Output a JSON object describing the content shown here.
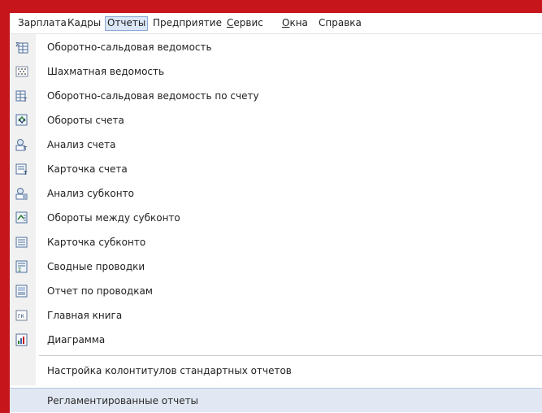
{
  "menubar": {
    "items": [
      {
        "label": "Зарплата"
      },
      {
        "label": "Кадры"
      },
      {
        "label": "Отчеты"
      },
      {
        "label": "Предприятие"
      },
      {
        "label": "ервис",
        "mnemonic": "С"
      },
      {
        "label": "кна",
        "mnemonic": "О"
      },
      {
        "label": "Справка"
      }
    ],
    "active_index": 2
  },
  "reports_menu": {
    "items": [
      {
        "label": "Оборотно-сальдовая ведомость",
        "icon": "turnover-balance-sheet-icon"
      },
      {
        "label": "Шахматная ведомость",
        "icon": "chess-sheet-icon"
      },
      {
        "label": "Оборотно-сальдовая ведомость по счету",
        "icon": "account-turnover-balance-icon"
      },
      {
        "label": "Обороты счета",
        "icon": "account-turnovers-icon"
      },
      {
        "label": "Анализ счета",
        "icon": "account-analysis-icon"
      },
      {
        "label": "Карточка счета",
        "icon": "account-card-icon"
      },
      {
        "label": "Анализ субконто",
        "icon": "subconto-analysis-icon"
      },
      {
        "label": "Обороты между субконто",
        "icon": "subconto-turnovers-icon"
      },
      {
        "label": "Карточка субконто",
        "icon": "subconto-card-icon"
      },
      {
        "label": "Сводные проводки",
        "icon": "summary-entries-icon"
      },
      {
        "label": "Отчет по проводкам",
        "icon": "entries-report-icon"
      },
      {
        "label": "Главная книга",
        "icon": "general-ledger-icon"
      },
      {
        "label": "Диаграмма",
        "icon": "diagram-icon"
      }
    ],
    "header_footer_settings": "Настройка колонтитулов стандартных отчетов",
    "regulated_reports": "Регламентированные отчеты"
  },
  "colors": {
    "frame": "#c6161b",
    "highlight": "#e1e8f3",
    "active_menu": "#dbe6f6"
  }
}
